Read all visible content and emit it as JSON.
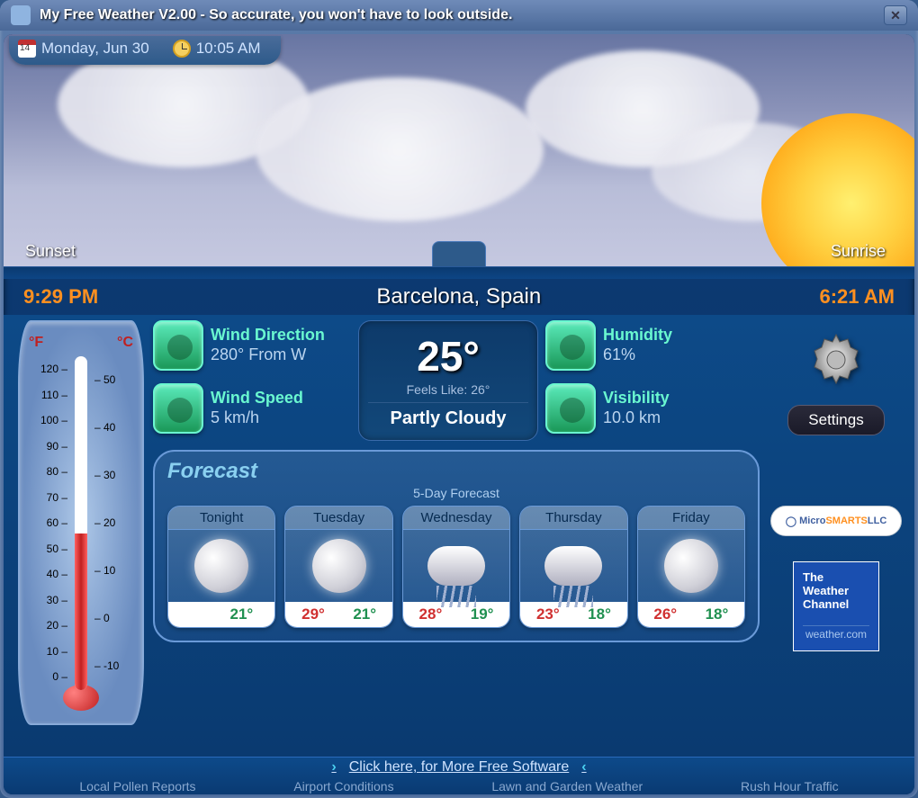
{
  "title": "My Free Weather V2.00  -   So accurate, you won't have to look outside.",
  "date": "Monday, Jun 30",
  "time": "10:05 AM",
  "calendar_day": "14",
  "sky": {
    "left_tab": "Sunset",
    "right_tab": "Sunrise"
  },
  "sunset": "9:29 PM",
  "sunrise": "6:21 AM",
  "location": "Barcelona, Spain",
  "thermo": {
    "f_label": "°F",
    "c_label": "°C",
    "f_scale": [
      "120",
      "110",
      "100",
      "90",
      "80",
      "70",
      "60",
      "50",
      "40",
      "30",
      "20",
      "10",
      "0"
    ],
    "c_scale": [
      "50",
      "40",
      "30",
      "20",
      "10",
      "0",
      "-10"
    ]
  },
  "stats": {
    "wind_dir_label": "Wind Direction",
    "wind_dir_value": "280° From W",
    "wind_speed_label": "Wind Speed",
    "wind_speed_value": "5 km/h",
    "humidity_label": "Humidity",
    "humidity_value": "61%",
    "visibility_label": "Visibility",
    "visibility_value": "10.0 km"
  },
  "current": {
    "temp": "25°",
    "feels": "Feels Like: 26°",
    "cond": "Partly Cloudy"
  },
  "settings_label": "Settings",
  "forecast": {
    "title": "Forecast",
    "subtitle": "5-Day Forecast",
    "days": [
      {
        "name": "Tonight",
        "icon": "sunny",
        "hi": "",
        "lo": "21°"
      },
      {
        "name": "Tuesday",
        "icon": "sunny",
        "hi": "29°",
        "lo": "21°"
      },
      {
        "name": "Wednesday",
        "icon": "rainy",
        "hi": "28°",
        "lo": "19°"
      },
      {
        "name": "Thursday",
        "icon": "rainy",
        "hi": "23°",
        "lo": "18°"
      },
      {
        "name": "Friday",
        "icon": "sunny",
        "hi": "26°",
        "lo": "18°"
      }
    ]
  },
  "branding": {
    "ms1": "Micro",
    "ms2": "SMARTS",
    "ms3": "LLC",
    "wc1": "The",
    "wc2": "Weather",
    "wc3": "Channel",
    "wc4": "weather.com"
  },
  "footer": {
    "click": "Click here, for More Free Software",
    "links": [
      "Local Pollen Reports",
      "Airport Conditions",
      "Lawn and Garden Weather",
      "Rush Hour Traffic"
    ]
  }
}
